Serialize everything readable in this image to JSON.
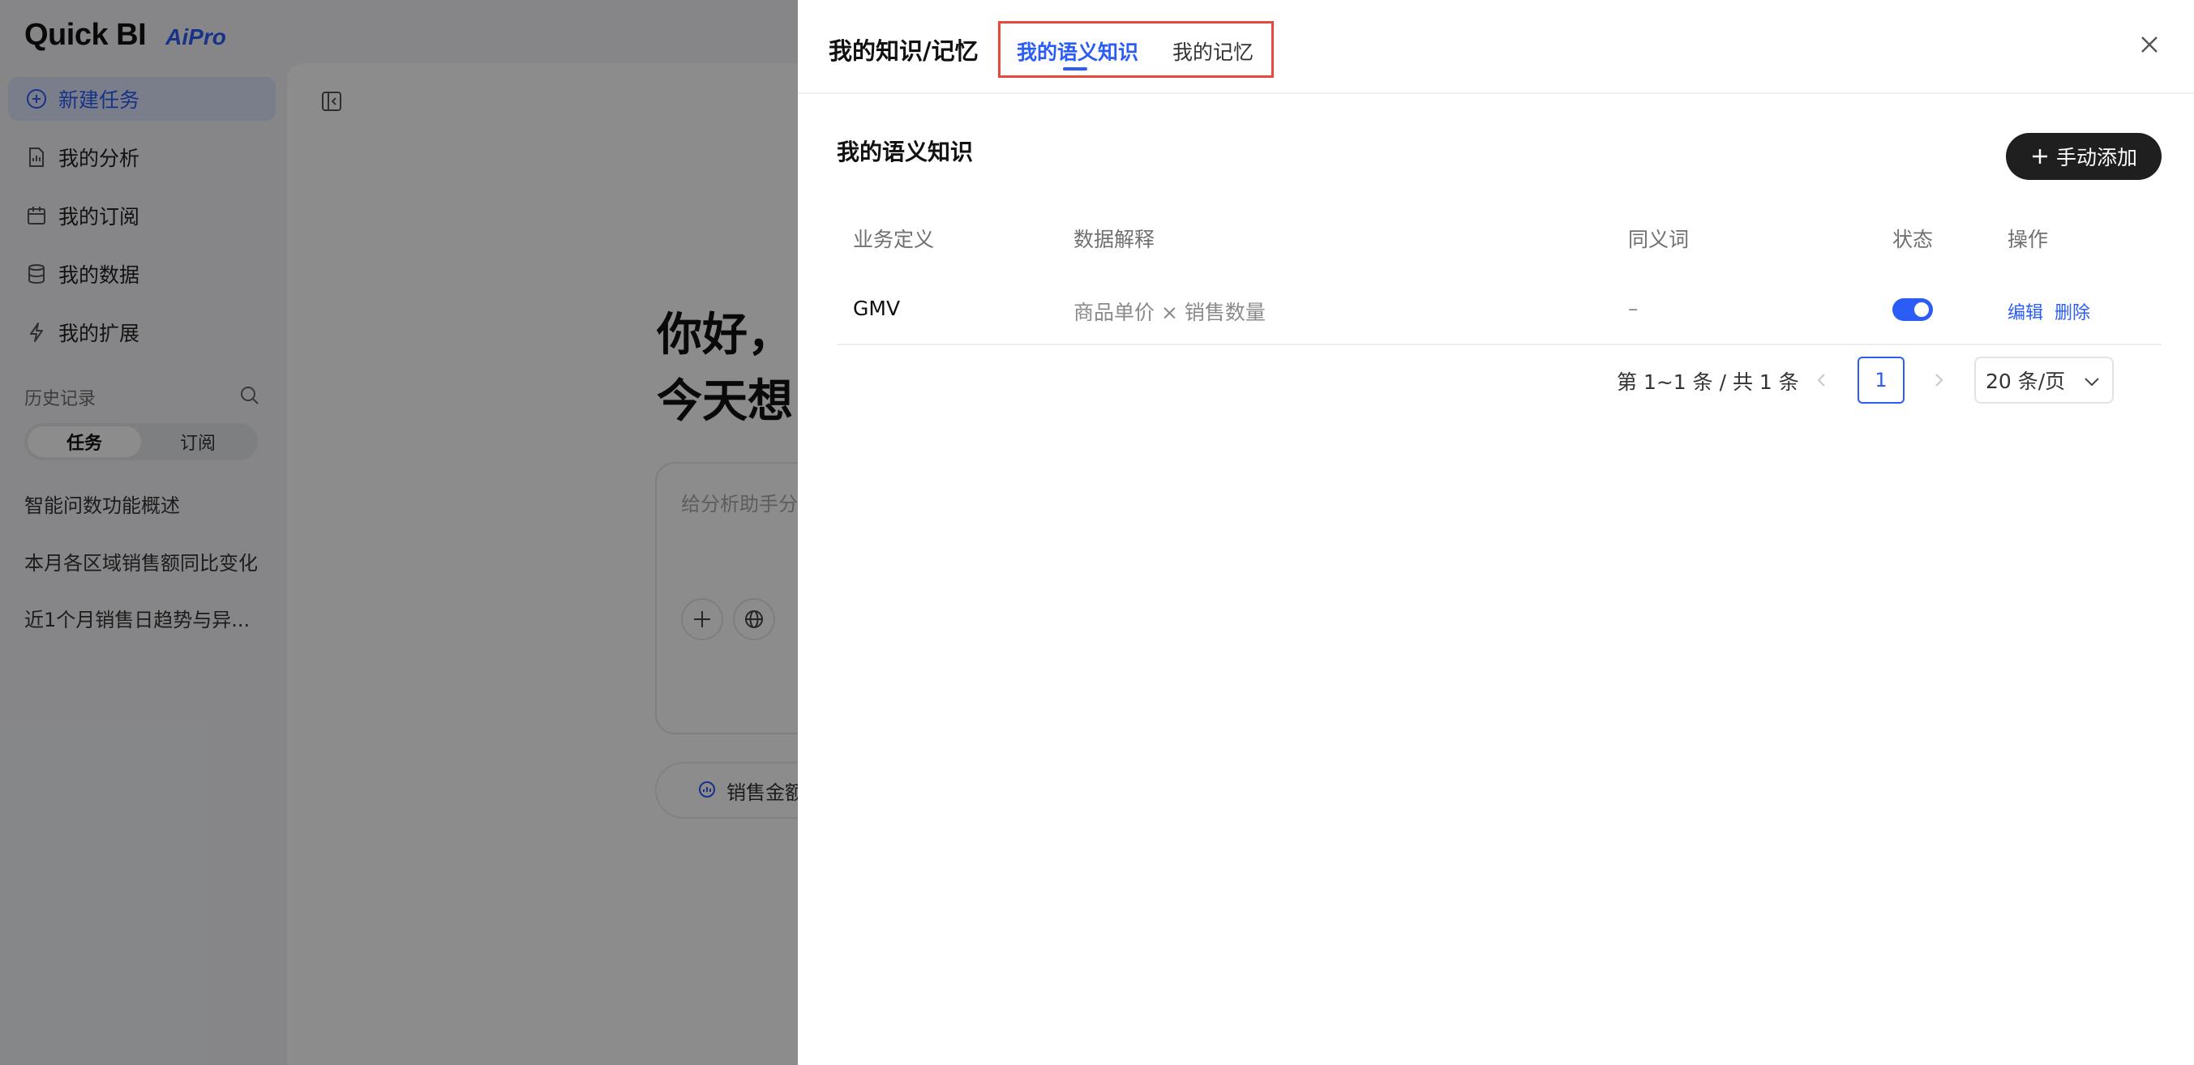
{
  "app": {
    "logo": "Quick BI",
    "logo_badge": "AiPro"
  },
  "sidebar": {
    "items": [
      {
        "label": "新建任务",
        "icon": "plus-circle-icon",
        "active": true
      },
      {
        "label": "我的分析",
        "icon": "document-icon"
      },
      {
        "label": "我的订阅",
        "icon": "calendar-icon"
      },
      {
        "label": "我的数据",
        "icon": "database-icon"
      },
      {
        "label": "我的扩展",
        "icon": "lightning-icon"
      }
    ],
    "history_title": "历史记录",
    "history_tabs": [
      "任务",
      "订阅"
    ],
    "history_items": [
      "智能问数功能概述",
      "本月各区域销售额同比变化",
      "近1个月销售日趋势与异..."
    ]
  },
  "main": {
    "greeting_line1": "你好，",
    "greeting_line2": "今天想",
    "input_placeholder": "给分析助手分",
    "chip_label": "销售金额"
  },
  "drawer": {
    "title": "我的知识/记忆",
    "tabs": [
      {
        "label": "我的语义知识",
        "active": true
      },
      {
        "label": "我的记忆",
        "active": false
      }
    ],
    "section_title": "我的语义知识",
    "add_button": "手动添加",
    "table": {
      "columns": [
        "业务定义",
        "数据解释",
        "同义词",
        "状态",
        "操作"
      ],
      "rows": [
        {
          "definition": "GMV",
          "explanation": "商品单价 × 销售数量",
          "synonyms": "–",
          "enabled": true,
          "actions": [
            "编辑",
            "删除"
          ]
        }
      ]
    },
    "pagination": {
      "total_text": "第 1~1 条 / 共 1 条",
      "current_page": "1",
      "page_size": "20 条/页"
    }
  },
  "colors": {
    "accent": "#2b5cf6",
    "highlight_box": "#e8473b",
    "primary_button": "#1f1f1f"
  }
}
